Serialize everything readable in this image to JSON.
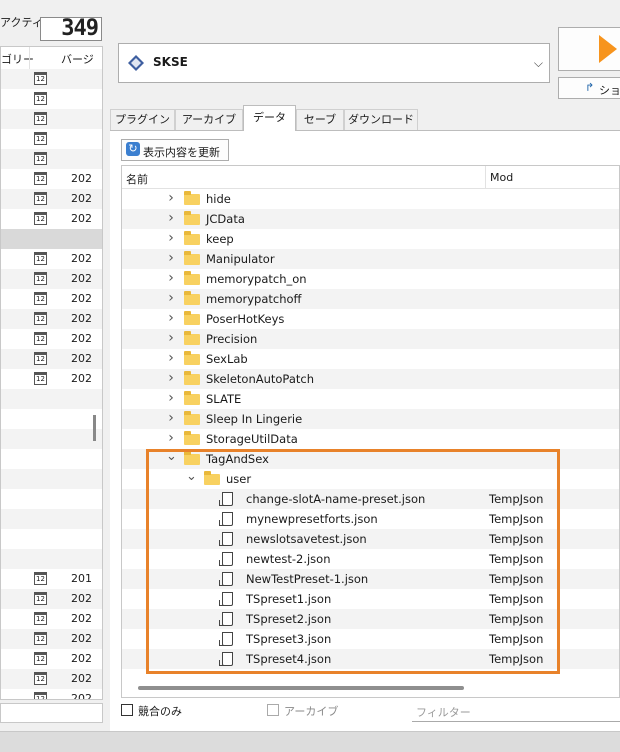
{
  "left_panel": {
    "active_label": "アクティブ:",
    "active_count": "349",
    "headers": [
      "ゴリー",
      "バージ"
    ],
    "rows": [
      {
        "cal": "12",
        "text": "",
        "style": "alt"
      },
      {
        "cal": "12",
        "text": "",
        "style": ""
      },
      {
        "cal": "12",
        "text": "",
        "style": "alt"
      },
      {
        "cal": "12",
        "text": "",
        "style": ""
      },
      {
        "cal": "12",
        "text": "",
        "style": "alt"
      },
      {
        "cal": "12",
        "text": "202",
        "style": ""
      },
      {
        "cal": "12",
        "text": "202",
        "style": "alt"
      },
      {
        "cal": "12",
        "text": "202",
        "style": ""
      },
      {
        "cal": "",
        "text": "",
        "style": "sep"
      },
      {
        "cal": "12",
        "text": "202",
        "style": ""
      },
      {
        "cal": "12",
        "text": "202",
        "style": "alt"
      },
      {
        "cal": "12",
        "text": "202",
        "style": ""
      },
      {
        "cal": "12",
        "text": "202",
        "style": "alt"
      },
      {
        "cal": "12",
        "text": "202",
        "style": ""
      },
      {
        "cal": "12",
        "text": "202",
        "style": "alt"
      },
      {
        "cal": "12",
        "text": "202",
        "style": ""
      },
      {
        "cal": "",
        "text": "",
        "style": "alt"
      },
      {
        "cal": "",
        "text": "",
        "style": ""
      },
      {
        "cal": "",
        "text": "",
        "style": "alt"
      },
      {
        "cal": "",
        "text": "",
        "style": ""
      },
      {
        "cal": "",
        "text": "",
        "style": "alt"
      },
      {
        "cal": "",
        "text": "",
        "style": ""
      },
      {
        "cal": "",
        "text": "",
        "style": "alt"
      },
      {
        "cal": "",
        "text": "",
        "style": ""
      },
      {
        "cal": "",
        "text": "",
        "style": "alt"
      },
      {
        "cal": "12",
        "text": "201",
        "style": ""
      },
      {
        "cal": "12",
        "text": "202",
        "style": "alt"
      },
      {
        "cal": "12",
        "text": "202",
        "style": ""
      },
      {
        "cal": "12",
        "text": "202",
        "style": "alt"
      },
      {
        "cal": "12",
        "text": "202",
        "style": ""
      },
      {
        "cal": "12",
        "text": "202",
        "style": "alt"
      },
      {
        "cal": "12",
        "text": "202",
        "style": ""
      }
    ]
  },
  "profile": {
    "name": "SKSE"
  },
  "shortcut_label": "ショー",
  "tabs": [
    {
      "label": "プラグイン",
      "active": false
    },
    {
      "label": "アーカイブ",
      "active": false
    },
    {
      "label": "データ",
      "active": true
    },
    {
      "label": "セーブ",
      "active": false
    },
    {
      "label": "ダウンロード",
      "active": false
    }
  ],
  "refresh_label": "表示内容を更新",
  "tree": {
    "col_name": "名前",
    "col_mod": "Mod",
    "rows": [
      {
        "type": "folder",
        "level": 1,
        "expand": "collapsed",
        "name": "hide",
        "mod": ""
      },
      {
        "type": "folder",
        "level": 1,
        "expand": "collapsed",
        "name": "JCData",
        "mod": ""
      },
      {
        "type": "folder",
        "level": 1,
        "expand": "collapsed",
        "name": "keep",
        "mod": ""
      },
      {
        "type": "folder",
        "level": 1,
        "expand": "collapsed",
        "name": "Manipulator",
        "mod": ""
      },
      {
        "type": "folder",
        "level": 1,
        "expand": "collapsed",
        "name": "memorypatch_on",
        "mod": ""
      },
      {
        "type": "folder",
        "level": 1,
        "expand": "collapsed",
        "name": "memorypatchoff",
        "mod": ""
      },
      {
        "type": "folder",
        "level": 1,
        "expand": "collapsed",
        "name": "PoserHotKeys",
        "mod": ""
      },
      {
        "type": "folder",
        "level": 1,
        "expand": "collapsed",
        "name": "Precision",
        "mod": ""
      },
      {
        "type": "folder",
        "level": 1,
        "expand": "collapsed",
        "name": "SexLab",
        "mod": ""
      },
      {
        "type": "folder",
        "level": 1,
        "expand": "collapsed",
        "name": "SkeletonAutoPatch",
        "mod": ""
      },
      {
        "type": "folder",
        "level": 1,
        "expand": "collapsed",
        "name": "SLATE",
        "mod": ""
      },
      {
        "type": "folder",
        "level": 1,
        "expand": "collapsed",
        "name": "Sleep In Lingerie",
        "mod": ""
      },
      {
        "type": "folder",
        "level": 1,
        "expand": "collapsed",
        "name": "StorageUtilData",
        "mod": ""
      },
      {
        "type": "folder",
        "level": 1,
        "expand": "expanded",
        "name": "TagAndSex",
        "mod": ""
      },
      {
        "type": "folder",
        "level": 2,
        "expand": "expanded",
        "name": "user",
        "mod": ""
      },
      {
        "type": "file",
        "level": 3,
        "name": "change-slotA-name-preset.json",
        "mod": "TempJson"
      },
      {
        "type": "file",
        "level": 3,
        "name": "mynewpresetforts.json",
        "mod": "TempJson"
      },
      {
        "type": "file",
        "level": 3,
        "name": "newslotsavetest.json",
        "mod": "TempJson"
      },
      {
        "type": "file",
        "level": 3,
        "name": "newtest-2.json",
        "mod": "TempJson"
      },
      {
        "type": "file",
        "level": 3,
        "name": "NewTestPreset-1.json",
        "mod": "TempJson"
      },
      {
        "type": "file",
        "level": 3,
        "name": "TSpreset1.json",
        "mod": "TempJson"
      },
      {
        "type": "file",
        "level": 3,
        "name": "TSpreset2.json",
        "mod": "TempJson"
      },
      {
        "type": "file",
        "level": 3,
        "name": "TSpreset3.json",
        "mod": "TempJson"
      },
      {
        "type": "file",
        "level": 3,
        "name": "TSpreset4.json",
        "mod": "TempJson"
      }
    ]
  },
  "bottom": {
    "conflict_label": "競合のみ",
    "archive_label": "アーカイブ",
    "filter_placeholder": "フィルター"
  },
  "colors": {
    "highlight": "#e8822a",
    "folder": "#f8d160",
    "run_arrow": "#f7941d"
  }
}
